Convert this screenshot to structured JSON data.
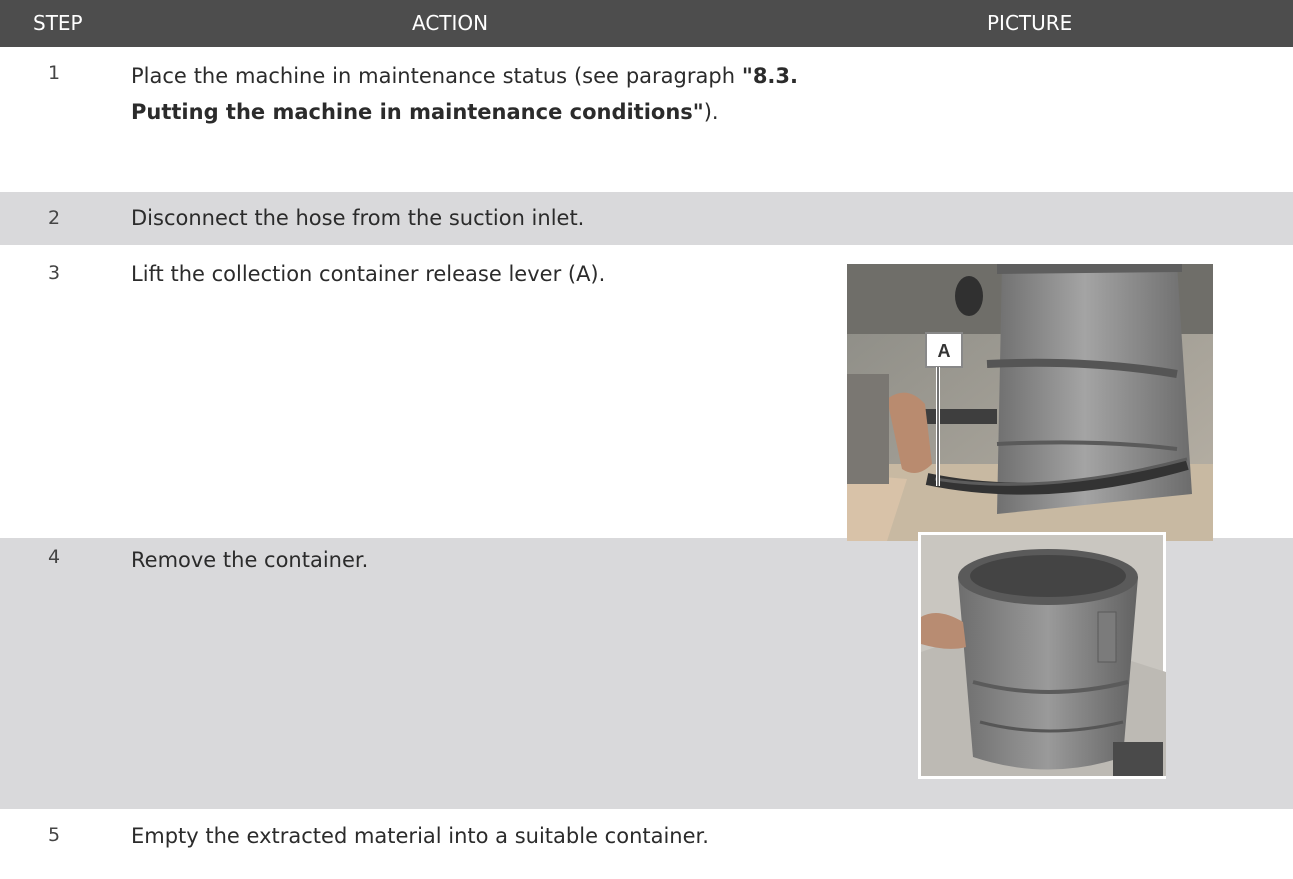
{
  "header": {
    "step": "STEP",
    "action": "ACTION",
    "picture": "PICTURE"
  },
  "rows": [
    {
      "step": "1",
      "action_prefix": "Place the machine in maintenance status (see paragraph ",
      "action_bold": "\"8.3. Putting the machine in maintenance conditions\"",
      "action_suffix": ")."
    },
    {
      "step": "2",
      "action": "Disconnect the hose from the suction inlet."
    },
    {
      "step": "3",
      "action": "Lift the collection container release lever (A).",
      "picture_callout": "A"
    },
    {
      "step": "4",
      "action": "Remove the container."
    },
    {
      "step": "5",
      "action": "Empty the extracted material into a suitable container."
    }
  ],
  "colors": {
    "header_bg": "#4d4d4d",
    "shaded_row_bg": "#d9d9db"
  }
}
